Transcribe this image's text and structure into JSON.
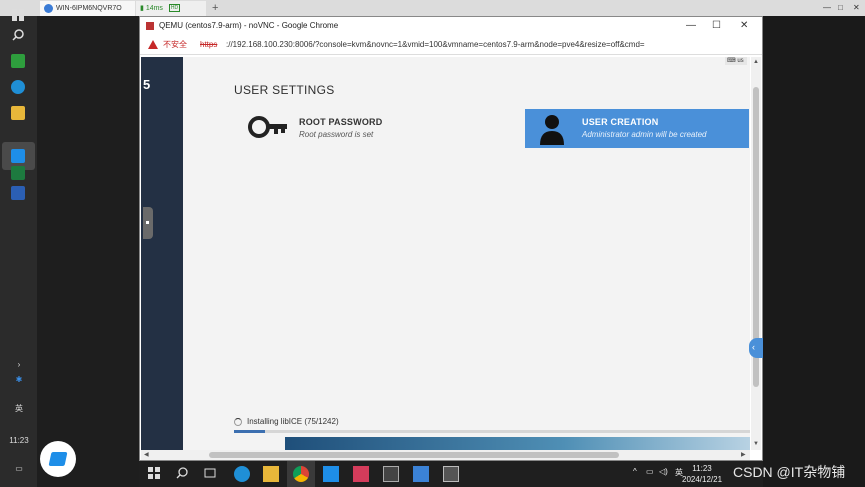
{
  "remote": {
    "tab_title": "WIN-6IPM6NQVR7O",
    "latency": "14ms",
    "quality": "HD",
    "new_tab": "+",
    "minimize": "—",
    "restore": "□",
    "close": "✕"
  },
  "sidebar": {
    "chevron": "›",
    "lang": "英",
    "time": "11:23"
  },
  "browser": {
    "title": "QEMU (centos7.9-arm) - noVNC - Google Chrome",
    "minimize": "—",
    "maximize": "☐",
    "close": "✕",
    "insecure_label": "不安全",
    "url_scheme": "https",
    "url_rest": "://192.168.100.230:8006/?console=kvm&novnc=1&vmid=100&vmname=centos7.9-arm&node=pve4&resize=off&cmd="
  },
  "installer": {
    "side_number": "5",
    "keyboard_badge": "us",
    "section_title": "USER SETTINGS",
    "spokes": [
      {
        "name": "ROOT PASSWORD",
        "status": "Root password is set"
      },
      {
        "name": "USER CREATION",
        "status": "Administrator admin will be created"
      }
    ],
    "progress": {
      "text": "Installing libICE (75/1242)",
      "fraction": 0.0604
    }
  },
  "taskbar": {
    "tray_lang": "英",
    "time": "11:23",
    "date": "2024/12/21"
  },
  "watermark": "CSDN @IT杂物铺",
  "colors": {
    "accent": "#4a90d9",
    "sidebar": "#233044",
    "warning": "#c62828"
  }
}
